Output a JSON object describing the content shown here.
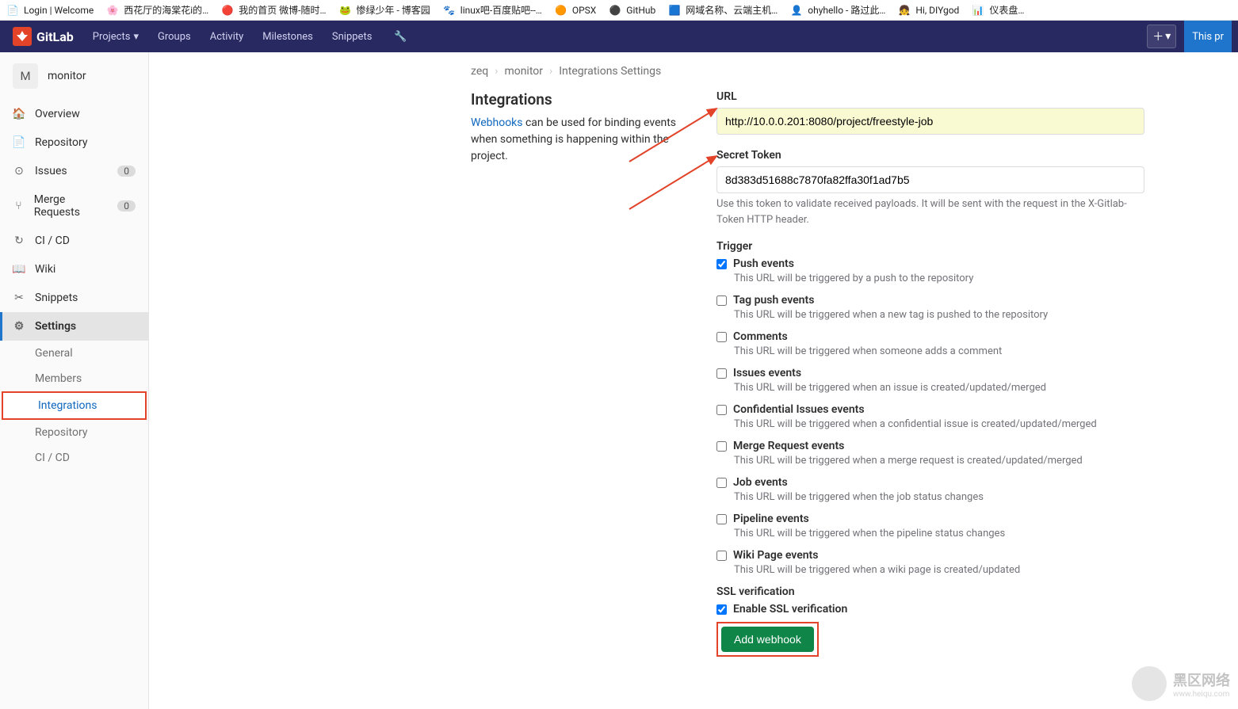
{
  "bookmarks": [
    {
      "icon": "📄",
      "label": "Login | Welcome"
    },
    {
      "icon": "🌸",
      "label": "西花厅的海棠花i的…"
    },
    {
      "icon": "🔴",
      "label": "我的首页 微博-随时…"
    },
    {
      "icon": "🐸",
      "label": "惨绿少年 - 博客园"
    },
    {
      "icon": "🐾",
      "label": "linux吧-百度贴吧--…"
    },
    {
      "icon": "🟠",
      "label": "OPSX"
    },
    {
      "icon": "⚫",
      "label": "GitHub"
    },
    {
      "icon": "🟦",
      "label": "网域名称、云端主机…"
    },
    {
      "icon": "👤",
      "label": "ohyhello - 路过此…"
    },
    {
      "icon": "👧",
      "label": "Hi, DIYgod"
    },
    {
      "icon": "📊",
      "label": "仪表盘…"
    }
  ],
  "topnav": {
    "brand": "GitLab",
    "items": [
      "Projects",
      "Groups",
      "Activity",
      "Milestones",
      "Snippets"
    ],
    "this_pr": "This pr"
  },
  "project": {
    "initial": "M",
    "name": "monitor"
  },
  "sidebar": {
    "items": [
      {
        "icon": "🏠",
        "label": "Overview"
      },
      {
        "icon": "📄",
        "label": "Repository"
      },
      {
        "icon": "⊙",
        "label": "Issues",
        "badge": "0"
      },
      {
        "icon": "⑂",
        "label": "Merge Requests",
        "badge": "0"
      },
      {
        "icon": "↻",
        "label": "CI / CD"
      },
      {
        "icon": "📖",
        "label": "Wiki"
      },
      {
        "icon": "✂",
        "label": "Snippets"
      },
      {
        "icon": "⚙",
        "label": "Settings"
      }
    ],
    "subs": [
      "General",
      "Members",
      "Integrations",
      "Repository",
      "CI / CD"
    ]
  },
  "breadcrumbs": {
    "a": "zeq",
    "b": "monitor",
    "c": "Integrations Settings"
  },
  "section": {
    "title": "Integrations",
    "desc_link": "Webhooks",
    "desc_rest": " can be used for binding events when something is happening within the project."
  },
  "form": {
    "url_label": "URL",
    "url_value": "http://10.0.0.201:8080/project/freestyle-job",
    "token_label": "Secret Token",
    "token_value": "8d383d51688c7870fa82ffa30f1ad7b5",
    "token_help": "Use this token to validate received payloads. It will be sent with the request in the X-Gitlab-Token HTTP header.",
    "trigger_label": "Trigger",
    "triggers": [
      {
        "label": "Push events",
        "desc": "This URL will be triggered by a push to the repository",
        "checked": true
      },
      {
        "label": "Tag push events",
        "desc": "This URL will be triggered when a new tag is pushed to the repository",
        "checked": false
      },
      {
        "label": "Comments",
        "desc": "This URL will be triggered when someone adds a comment",
        "checked": false
      },
      {
        "label": "Issues events",
        "desc": "This URL will be triggered when an issue is created/updated/merged",
        "checked": false
      },
      {
        "label": "Confidential Issues events",
        "desc": "This URL will be triggered when a confidential issue is created/updated/merged",
        "checked": false
      },
      {
        "label": "Merge Request events",
        "desc": "This URL will be triggered when a merge request is created/updated/merged",
        "checked": false
      },
      {
        "label": "Job events",
        "desc": "This URL will be triggered when the job status changes",
        "checked": false
      },
      {
        "label": "Pipeline events",
        "desc": "This URL will be triggered when the pipeline status changes",
        "checked": false
      },
      {
        "label": "Wiki Page events",
        "desc": "This URL will be triggered when a wiki page is created/updated",
        "checked": false
      }
    ],
    "ssl_label": "SSL verification",
    "ssl_check": "Enable SSL verification",
    "submit": "Add webhook"
  },
  "watermark": {
    "t": "黑区网络",
    "s": "www.heiqu.com"
  }
}
